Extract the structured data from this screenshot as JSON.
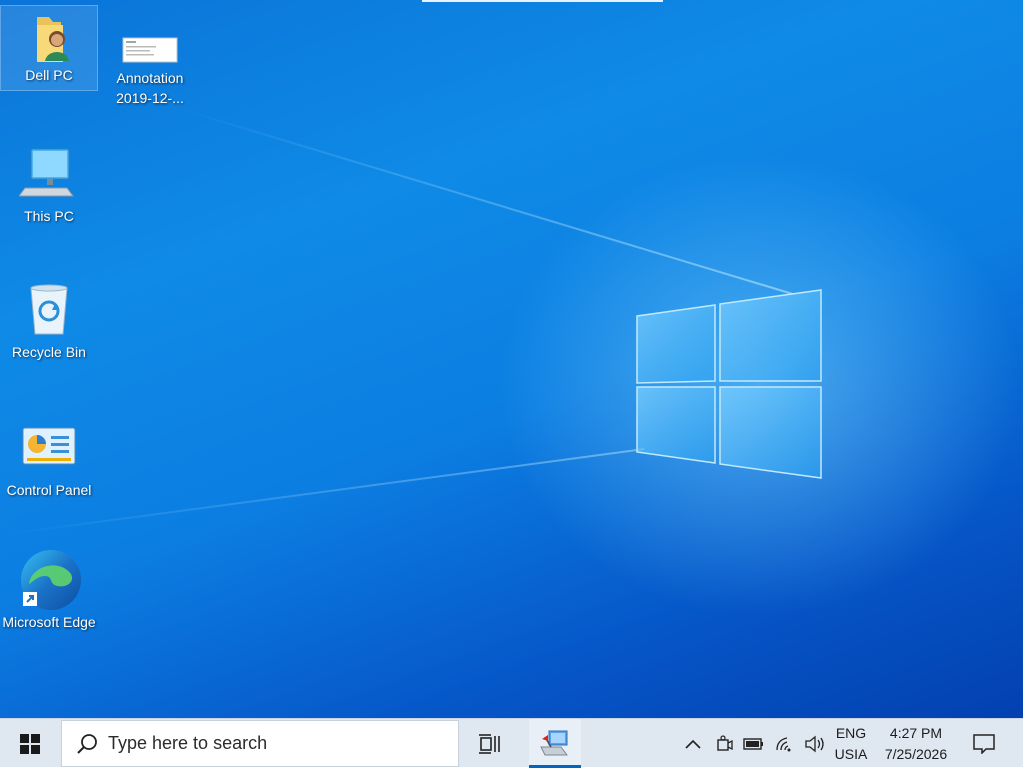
{
  "desktop": {
    "icons": [
      {
        "label": "Dell PC",
        "icon": "user-folder-icon"
      },
      {
        "label": "Annotation 2019-12-...",
        "icon": "screenshot-file-icon"
      },
      {
        "label": "This PC",
        "icon": "computer-icon"
      },
      {
        "label": "Recycle Bin",
        "icon": "recycle-bin-icon"
      },
      {
        "label": "Control Panel",
        "icon": "control-panel-icon"
      },
      {
        "label": "Microsoft Edge",
        "icon": "edge-icon"
      }
    ],
    "wallpaper": "windows-10-hero-logo"
  },
  "taskbar": {
    "start": {
      "icon": "windows-start-icon"
    },
    "search": {
      "placeholder": "Type here to search",
      "icon": "search-icon"
    },
    "task_view": {
      "icon": "task-view-icon"
    },
    "pinned_app": {
      "icon": "network-app-icon",
      "active": true
    },
    "tray": {
      "chevron_icon": "chevron-up-icon",
      "icons": [
        "meet-now-icon",
        "battery-icon",
        "wifi-icon",
        "volume-icon"
      ],
      "language": {
        "line1": "ENG",
        "line2": "USIA"
      },
      "clock": {
        "time": "4:27 PM",
        "date": "7/25/2026"
      },
      "notification_icon": "action-center-icon"
    }
  },
  "colors": {
    "accent": "#0a74d8",
    "taskbar": "#dfe7f1",
    "active_indicator": "#0067c0"
  }
}
